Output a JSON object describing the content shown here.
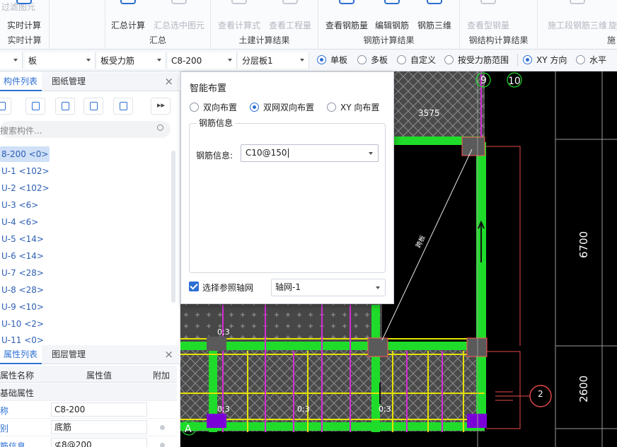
{
  "ribbon": {
    "top_left": "过滤图元",
    "groups": [
      {
        "title": "实时计算",
        "buttons": [
          {
            "label": "实时计算",
            "disabled": false
          }
        ]
      },
      {
        "title": "汇总",
        "buttons": [
          {
            "label": "汇总计算",
            "disabled": false
          },
          {
            "label": "汇总选中图元",
            "disabled": true
          }
        ]
      },
      {
        "title": "土建计算结果",
        "buttons": [
          {
            "label": "查看计算式",
            "disabled": true
          },
          {
            "label": "查看工程量",
            "disabled": true
          }
        ]
      },
      {
        "title": "钢筋计算结果",
        "buttons": [
          {
            "label": "查看钢筋量",
            "disabled": false
          },
          {
            "label": "编辑钢筋",
            "disabled": false
          },
          {
            "label": "钢筋三维",
            "disabled": false
          }
        ]
      },
      {
        "title": "钢结构计算结果",
        "buttons": [
          {
            "label": "查看型钢量",
            "disabled": true
          }
        ]
      },
      {
        "title": "施",
        "buttons": [
          {
            "label": "施工段钢筋三维",
            "disabled": true
          },
          {
            "label": "旋",
            "disabled": true
          }
        ]
      }
    ]
  },
  "toolbar": {
    "selects": [
      "板",
      "板受力筋",
      "C8-200",
      "分层板1"
    ],
    "radios": [
      {
        "label": "单板",
        "checked": true
      },
      {
        "label": "多板",
        "checked": false
      },
      {
        "label": "自定义",
        "checked": false
      },
      {
        "label": "按受力筋范围",
        "checked": false
      },
      {
        "label": "XY 方向",
        "checked": true
      },
      {
        "label": "水平",
        "checked": false
      }
    ]
  },
  "component_panel": {
    "tabs": [
      "构件列表",
      "图纸管理"
    ],
    "search_placeholder": "搜索构件...",
    "items": [
      "8-200 <0>",
      "U-1 <102>",
      "U-2 <102>",
      "U-3 <6>",
      "U-4 <6>",
      "U-5 <14>",
      "U-6 <14>",
      "U-7 <28>",
      "U-8 <28>",
      "U-9 <10>",
      "U-10 <2>",
      "U-11 <0>"
    ]
  },
  "property_panel": {
    "tabs": [
      "属性列表",
      "图层管理"
    ],
    "headers": [
      "属性名称",
      "属性值",
      "附加"
    ],
    "section": "基础属性",
    "rows": [
      {
        "name": "称",
        "value": "C8-200"
      },
      {
        "name": "别",
        "value": "底筋"
      },
      {
        "name": "筋信息",
        "value": "⊈8@200"
      }
    ]
  },
  "dialog": {
    "title": "智能布置",
    "modes": [
      {
        "label": "双向布置",
        "checked": false
      },
      {
        "label": "双网双向布置",
        "checked": true
      },
      {
        "label": "XY 向布置",
        "checked": false
      }
    ],
    "group_label": "钢筋信息",
    "field_label": "钢筋信息:",
    "field_value": "C10@150",
    "checkbox_label": "选择参照轴网",
    "checkbox_checked": true,
    "grid_select": "轴网-1"
  },
  "canvas": {
    "axis_labels": [
      "9",
      "10",
      "A",
      "2"
    ],
    "dims": [
      "3575",
      "6700",
      "2600"
    ],
    "small_labels": [
      "0;3",
      "0;3",
      "0;3",
      "0;3"
    ],
    "diag_label": "跨板"
  }
}
